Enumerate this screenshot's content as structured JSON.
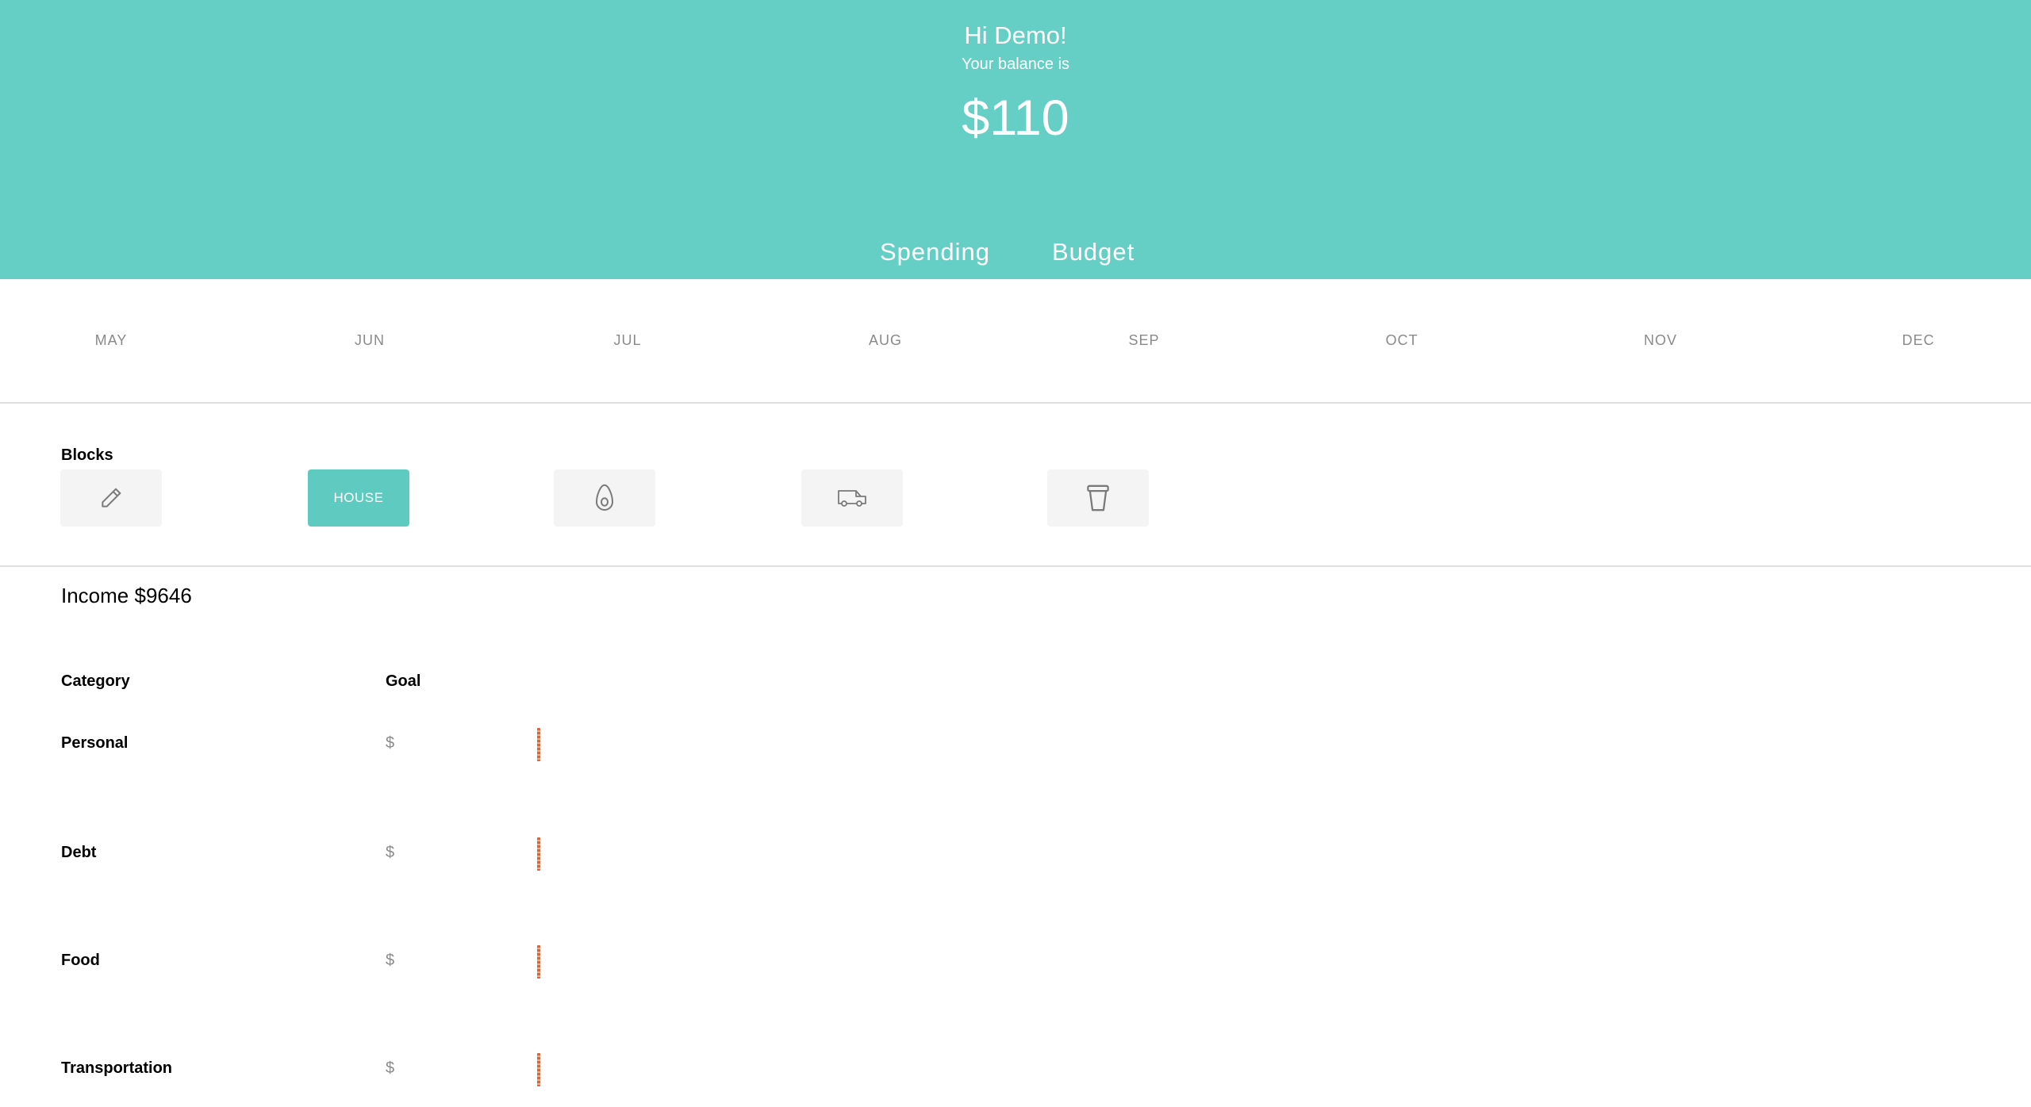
{
  "header": {
    "greeting": "Hi Demo!",
    "balance_caption": "Your balance is",
    "balance_amount": "$110",
    "background_color": "#66cfc5",
    "tabs": [
      {
        "label": "Spending"
      },
      {
        "label": "Budget"
      }
    ]
  },
  "months": [
    "MAY",
    "JUN",
    "JUL",
    "AUG",
    "SEP",
    "OCT",
    "NOV",
    "DEC"
  ],
  "blocks": {
    "title": "Blocks",
    "items": [
      {
        "icon": "pencil-icon",
        "label": ""
      },
      {
        "icon": "",
        "label": "HOUSE",
        "active": true
      },
      {
        "icon": "avocado-icon",
        "label": ""
      },
      {
        "icon": "truck-icon",
        "label": ""
      },
      {
        "icon": "cup-icon",
        "label": ""
      }
    ],
    "active_color": "#5fcbc0"
  },
  "income": {
    "text": "Income $9646"
  },
  "table": {
    "headers": {
      "category": "Category",
      "goal": "Goal"
    },
    "currency_symbol": "$",
    "rows": [
      {
        "name": "Personal"
      },
      {
        "name": "Debt"
      },
      {
        "name": "Food"
      },
      {
        "name": "Transportation"
      }
    ]
  }
}
